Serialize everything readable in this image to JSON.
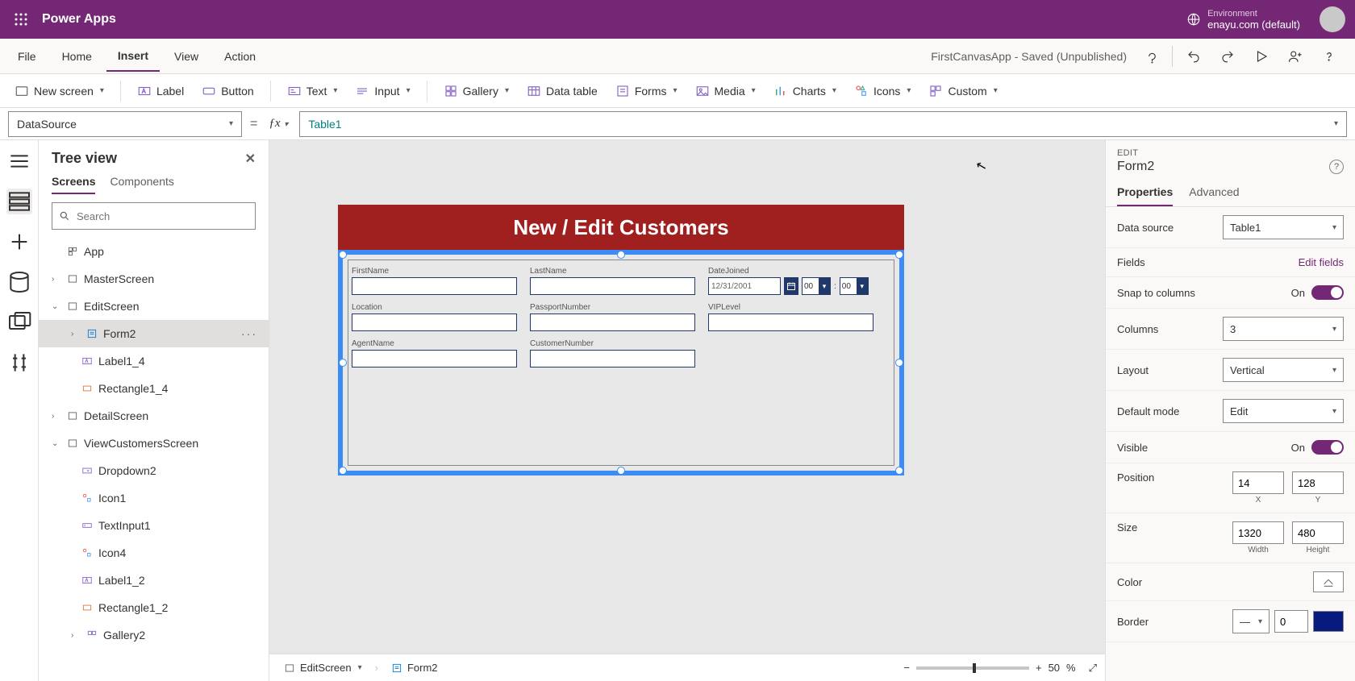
{
  "topbar": {
    "title": "Power Apps",
    "env_label": "Environment",
    "env_value": "enayu.com (default)"
  },
  "menubar": {
    "items": [
      "File",
      "Home",
      "Insert",
      "View",
      "Action"
    ],
    "active": 2,
    "app_status": "FirstCanvasApp - Saved (Unpublished)"
  },
  "ribbon": {
    "new_screen": "New screen",
    "label": "Label",
    "button": "Button",
    "text": "Text",
    "input": "Input",
    "gallery": "Gallery",
    "data_table": "Data table",
    "forms": "Forms",
    "media": "Media",
    "charts": "Charts",
    "icons": "Icons",
    "custom": "Custom"
  },
  "formula": {
    "property": "DataSource",
    "value": "Table1"
  },
  "tree": {
    "title": "Tree view",
    "tabs": [
      "Screens",
      "Components"
    ],
    "search_placeholder": "Search",
    "app": "App",
    "master": "MasterScreen",
    "edit": "EditScreen",
    "form2": "Form2",
    "label1_4": "Label1_4",
    "rect1_4": "Rectangle1_4",
    "detail": "DetailScreen",
    "viewcust": "ViewCustomersScreen",
    "dropdown2": "Dropdown2",
    "icon1": "Icon1",
    "textinput1": "TextInput1",
    "icon4": "Icon4",
    "label1_2": "Label1_2",
    "rect1_2": "Rectangle1_2",
    "gallery2": "Gallery2"
  },
  "preview": {
    "header": "New / Edit Customers",
    "fields": {
      "firstname": "FirstName",
      "lastname": "LastName",
      "datejoined": "DateJoined",
      "location": "Location",
      "passport": "PassportNumber",
      "vip": "VIPLevel",
      "agent": "AgentName",
      "custnum": "CustomerNumber"
    },
    "date_value": "12/31/2001",
    "hour": "00",
    "min": "00"
  },
  "status": {
    "screen": "EditScreen",
    "breadcrumb": "Form2",
    "zoom": "50",
    "zoom_unit": "%"
  },
  "props": {
    "label": "EDIT",
    "title": "Form2",
    "tabs": [
      "Properties",
      "Advanced"
    ],
    "data_source_label": "Data source",
    "data_source": "Table1",
    "fields_label": "Fields",
    "edit_fields": "Edit fields",
    "snap_label": "Snap to columns",
    "snap_on": "On",
    "columns_label": "Columns",
    "columns": "3",
    "layout_label": "Layout",
    "layout": "Vertical",
    "default_mode_label": "Default mode",
    "default_mode": "Edit",
    "visible_label": "Visible",
    "visible_on": "On",
    "position_label": "Position",
    "pos_x": "14",
    "pos_y": "128",
    "x_lbl": "X",
    "y_lbl": "Y",
    "size_label": "Size",
    "w": "1320",
    "h": "480",
    "w_lbl": "Width",
    "h_lbl": "Height",
    "color_label": "Color",
    "border_label": "Border",
    "border_w": "0"
  }
}
